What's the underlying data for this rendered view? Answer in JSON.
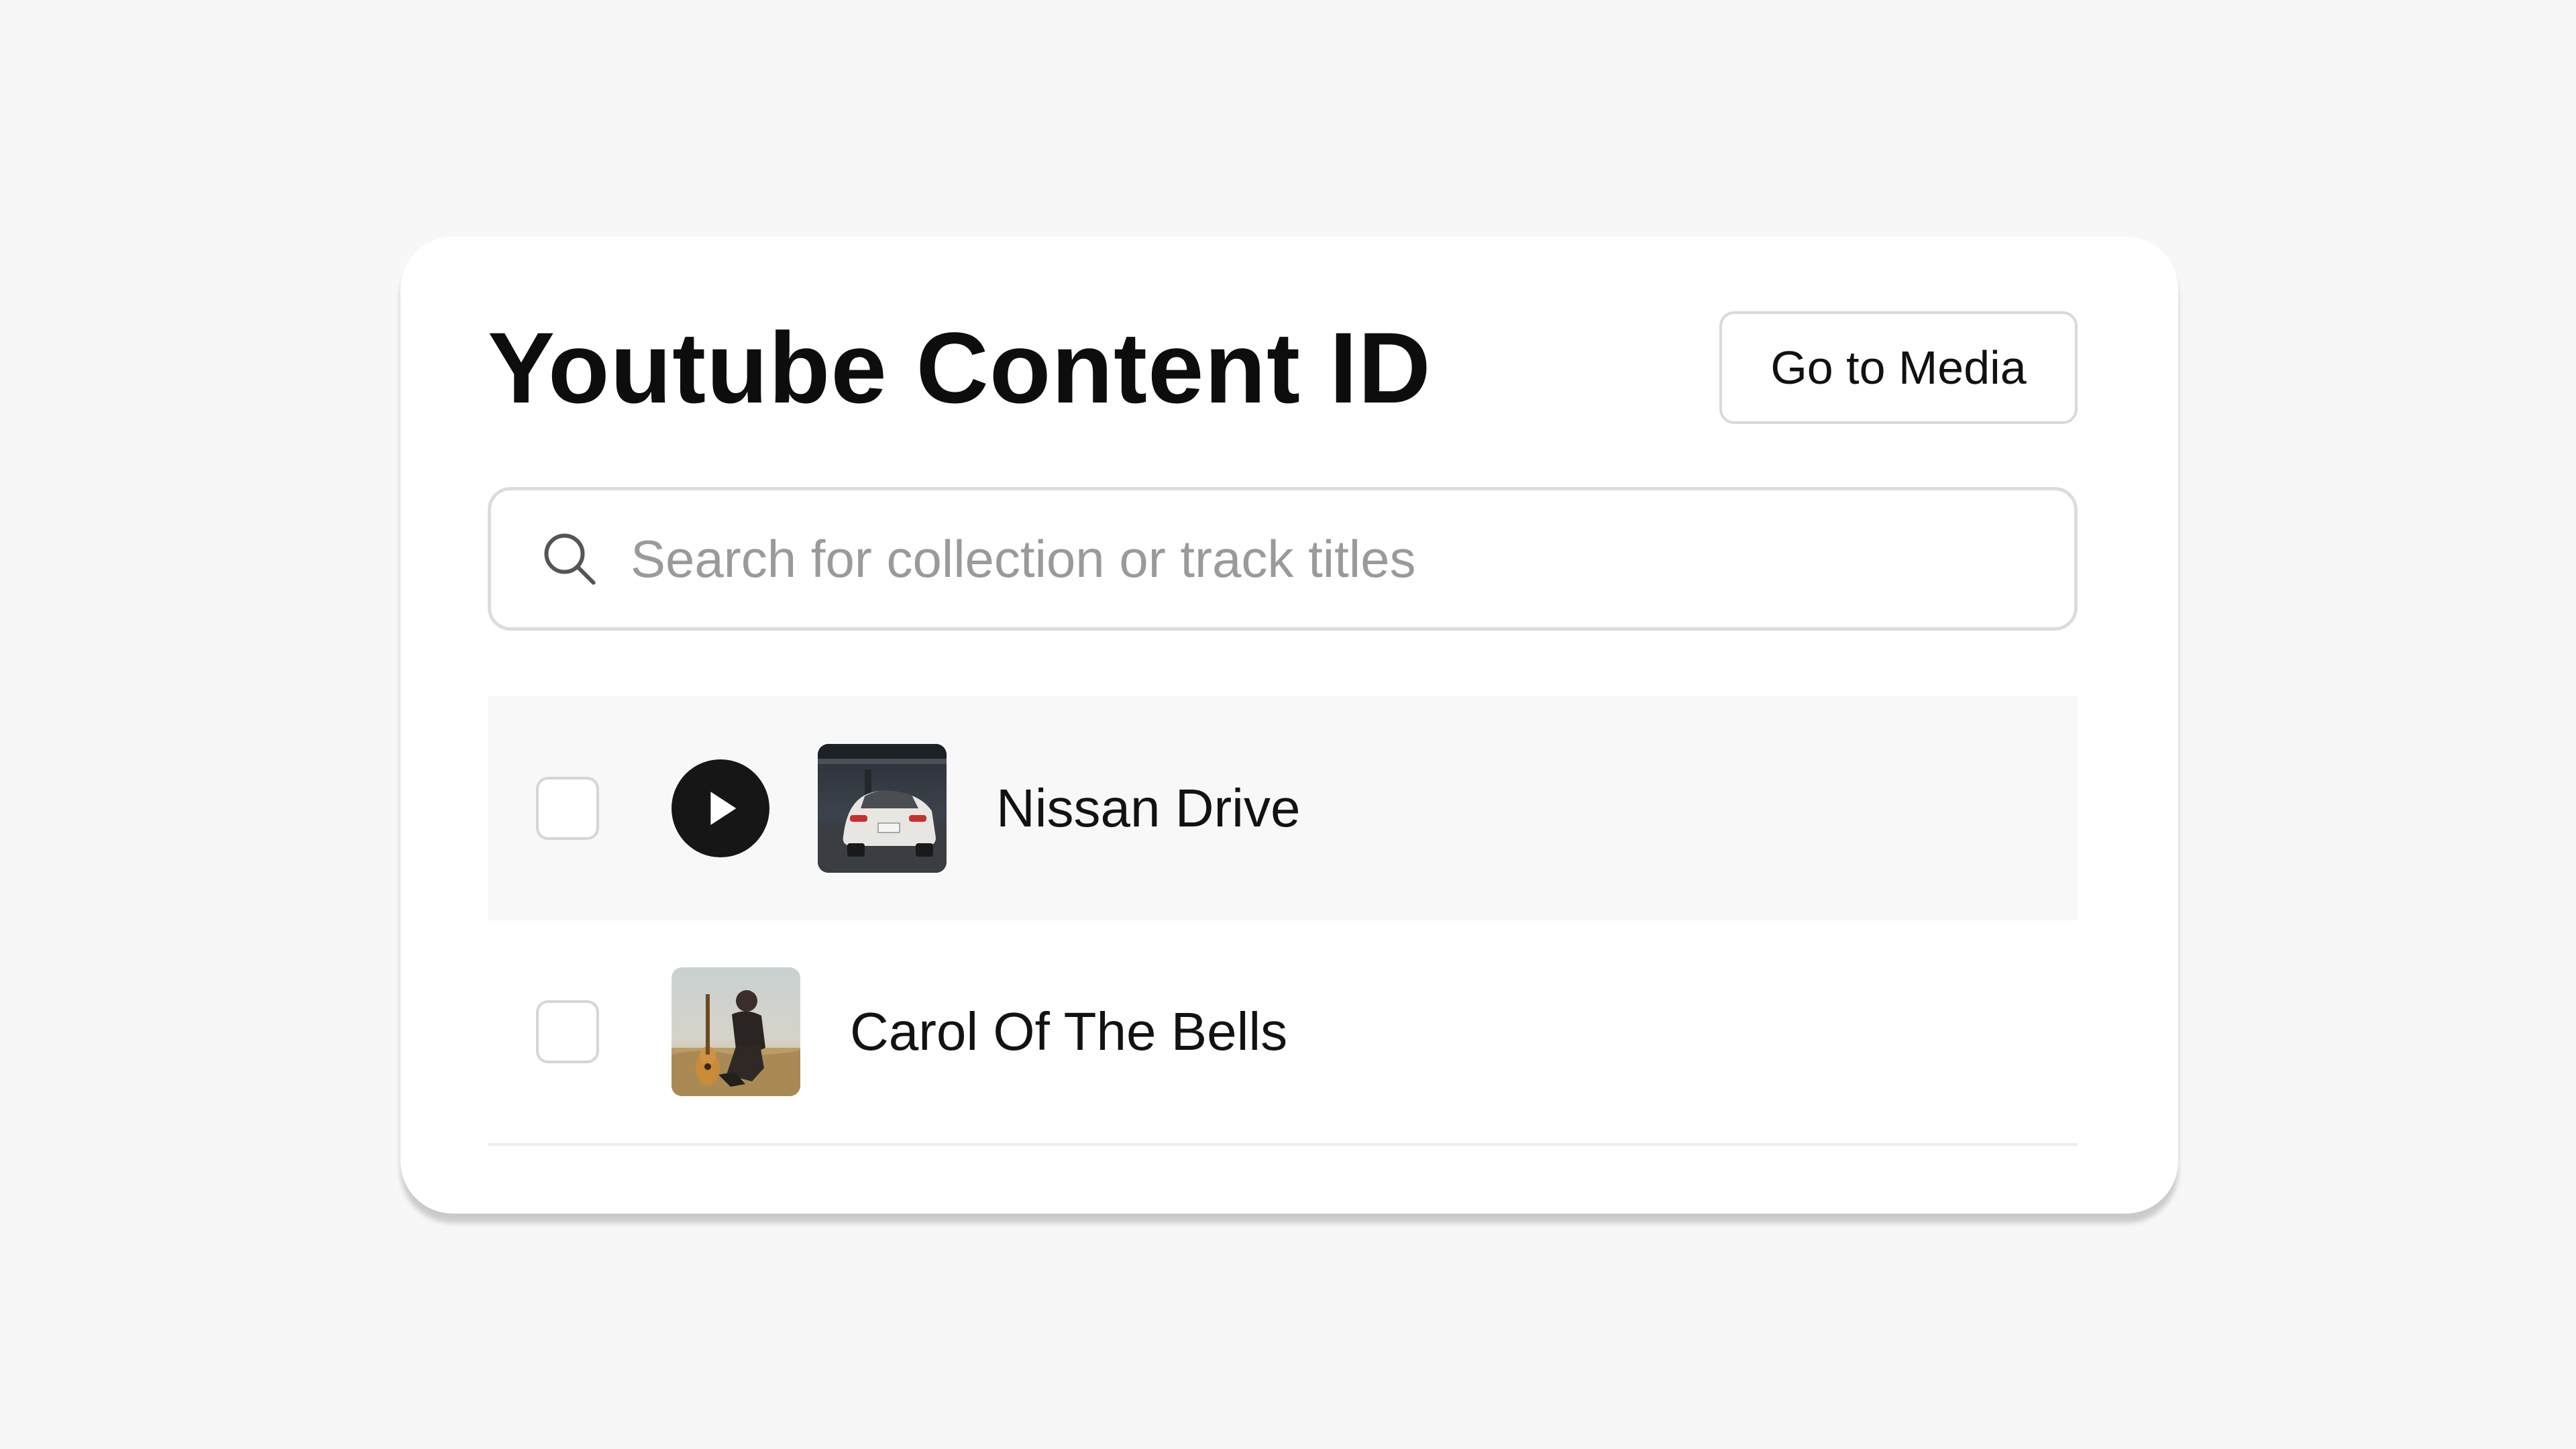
{
  "header": {
    "title": "Youtube Content ID",
    "go_to_media_label": "Go to Media"
  },
  "search": {
    "placeholder": "Search for collection or track titles",
    "value": ""
  },
  "tracks": [
    {
      "title": "Nissan Drive",
      "has_play_button": true,
      "thumbnail": "car-rear-night-thumbnail",
      "selected": false
    },
    {
      "title": "Carol Of The Bells",
      "has_play_button": false,
      "thumbnail": "guitarist-field-thumbnail",
      "selected": false
    }
  ],
  "colors": {
    "background": "#f7f7f7",
    "card": "#ffffff",
    "title_text": "#0d0d0d",
    "border": "#dcdcdc",
    "active_row": "#f8f8f8",
    "play_button": "#161616"
  }
}
